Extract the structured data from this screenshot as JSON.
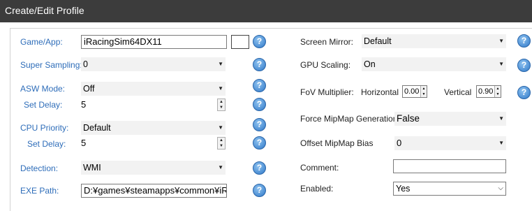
{
  "window": {
    "title": "Create/Edit Profile"
  },
  "left": {
    "game_label": "Game/App:",
    "game_value": "iRacingSim64DX11",
    "ss_label": "Super Sampling:",
    "ss_value": "0",
    "asw_label": "ASW Mode:",
    "asw_value": "Off",
    "asw_delay_label": "Set Delay:",
    "asw_delay_value": "5",
    "cpu_label": "CPU Priority:",
    "cpu_value": "Default",
    "cpu_delay_label": "Set Delay:",
    "cpu_delay_value": "5",
    "detection_label": "Detection:",
    "detection_value": "WMI",
    "exe_label": "EXE Path:",
    "exe_value": "D:¥games¥steamapps¥common¥iRa"
  },
  "right": {
    "mirror_label": "Screen Mirror:",
    "mirror_value": "Default",
    "gpu_label": "GPU Scaling:",
    "gpu_value": "On",
    "fov_label": "FoV Multiplier:",
    "fov_h_label": "Horizontal",
    "fov_h_value": "0.00",
    "fov_v_label": "Vertical",
    "fov_v_value": "0.90",
    "mipgen_label": "Force MipMap Generation",
    "mipgen_value": "False",
    "mipbias_label": "Offset MipMap Bias",
    "mipbias_value": "0",
    "comment_label": "Comment:",
    "comment_value": "",
    "enabled_label": "Enabled:",
    "enabled_value": "Yes"
  },
  "icons": {
    "help": "help-icon",
    "dropdown": "dropdown-arrow-icon"
  },
  "colors": {
    "title_bar": "#3c3c3c",
    "label_blue": "#2e6db9",
    "help_blue": "#2f78c8"
  }
}
